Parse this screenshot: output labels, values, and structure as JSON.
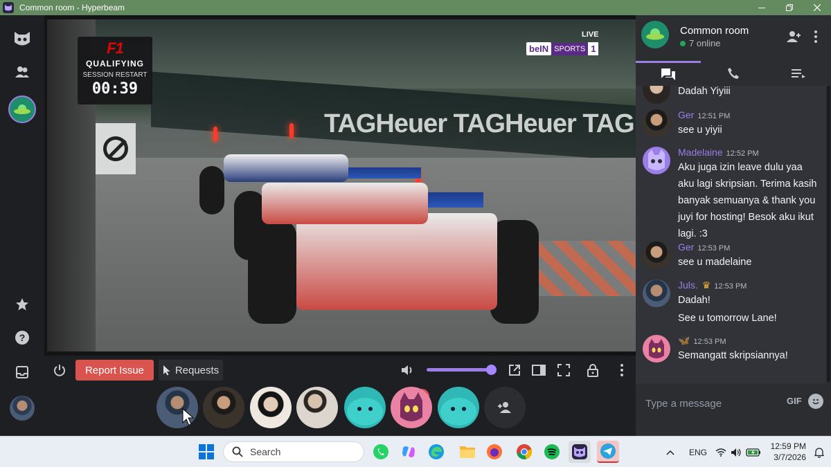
{
  "window": {
    "title": "Common room - Hyperbeam"
  },
  "video": {
    "f1_badge": {
      "brand": "F1",
      "session": "QUALIFYING",
      "status": "SESSION RESTART",
      "timer": "00:39"
    },
    "broadcaster": {
      "live": "LIVE",
      "logo": "beIN",
      "sports": "SPORTS",
      "channel": "1"
    },
    "ad_text": "TAGHeuer  TAGHeuer  TAGHeuer"
  },
  "controls": {
    "report_issue": "Report Issue",
    "requests": "Requests",
    "volume_level": 0.95
  },
  "chat": {
    "room_name": "Common room",
    "online": "7 online",
    "messages": [
      {
        "name": "",
        "time": "",
        "text": "Dadah Yiyiii",
        "name_color": "#b5bac1"
      },
      {
        "name": "Ger",
        "time": "12:51 PM",
        "text": "see u yiyii",
        "name_color": "#9b7fe6"
      },
      {
        "name": "Madelaine",
        "time": "12:52 PM",
        "text": "Aku juga izin leave dulu yaa aku lagi skripsian. Terima kasih banyak semuanya & thank you juyi for hosting! Besok aku ikut lagi. :3",
        "name_color": "#9b7fe6"
      },
      {
        "name": "Ger",
        "time": "12:53 PM",
        "text": "see u madelaine",
        "name_color": "#9b7fe6"
      },
      {
        "name": "Juls.",
        "time": "12:53 PM",
        "text": "Dadah!",
        "text2": "See u tomorrow Lane!",
        "name_color": "#9b7fe6"
      },
      {
        "name": "",
        "time": "12:53 PM",
        "text": "Semangatt skripsiannya!",
        "name_color": "#9b7fe6"
      }
    ],
    "composer": {
      "placeholder": "Type a message",
      "gif_label": "GIF"
    }
  },
  "taskbar": {
    "search_placeholder": "Search",
    "language": "ENG",
    "time": "12:59 PM",
    "date": "3/7/2026"
  }
}
